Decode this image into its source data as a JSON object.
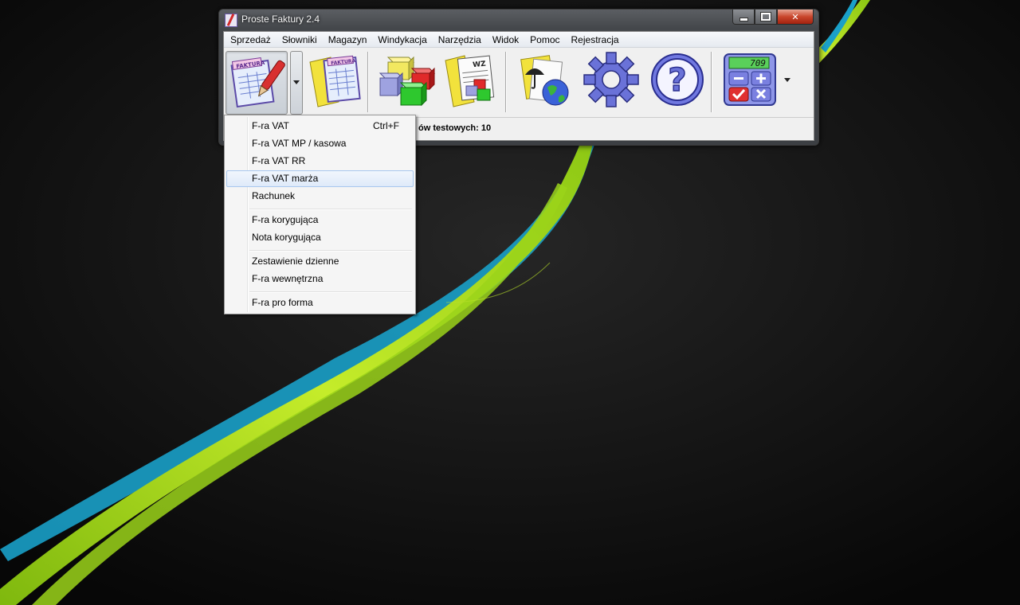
{
  "window": {
    "title": "Proste Faktury 2.4",
    "close_label": "✕"
  },
  "menubar": {
    "items": [
      "Sprzedaż",
      "Słowniki",
      "Magazyn",
      "Windykacja",
      "Narzędzia",
      "Widok",
      "Pomoc",
      "Rejestracja"
    ]
  },
  "toolbar": {
    "invoice_icon_text": "FAKTURA",
    "invoice_list_icon_text": "FAKTURA",
    "wz_icon_text": "WZ",
    "calculator_display": "709",
    "help_icon_glyph": "?"
  },
  "status": {
    "text": "ów testowych: 10"
  },
  "dropdown": {
    "items": [
      {
        "label": "F-ra VAT",
        "shortcut": "Ctrl+F"
      },
      {
        "label": "F-ra VAT MP / kasowa",
        "shortcut": ""
      },
      {
        "label": "F-ra VAT RR",
        "shortcut": ""
      },
      {
        "label": "F-ra VAT marża",
        "shortcut": ""
      },
      {
        "label": "Rachunek",
        "shortcut": ""
      },
      {
        "label": "F-ra korygująca",
        "shortcut": ""
      },
      {
        "label": "Nota korygująca",
        "shortcut": ""
      },
      {
        "label": "Zestawienie dzienne",
        "shortcut": ""
      },
      {
        "label": "F-ra wewnętrzna",
        "shortcut": ""
      },
      {
        "label": "F-ra pro forma",
        "shortcut": ""
      }
    ]
  },
  "colors": {
    "desktop_bg": "#0b0b0b",
    "ribbon_green": "#a6d81c",
    "ribbon_blue": "#1aa0c8",
    "menu_highlight": "#dfeaf9"
  }
}
